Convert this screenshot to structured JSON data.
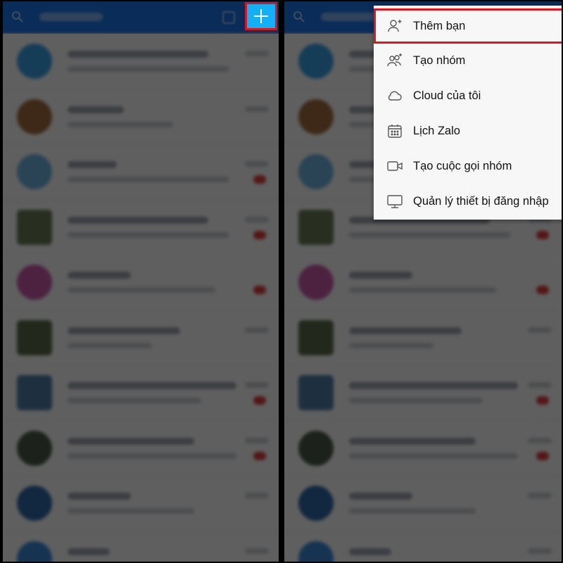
{
  "left_panel": {
    "plus_button_label": "+"
  },
  "right_panel": {
    "menu": {
      "items": [
        {
          "label": "Thêm bạn",
          "icon": "add-friend-icon"
        },
        {
          "label": "Tạo nhóm",
          "icon": "create-group-icon"
        },
        {
          "label": "Cloud của tôi",
          "icon": "cloud-icon"
        },
        {
          "label": "Lịch Zalo",
          "icon": "calendar-icon"
        },
        {
          "label": "Tạo cuộc gọi nhóm",
          "icon": "video-call-icon"
        },
        {
          "label": "Quản lý thiết bị đăng nhập",
          "icon": "monitor-icon"
        }
      ]
    }
  },
  "colors": {
    "header_blue": "#1b73e8",
    "plus_button_bg": "#12b0f7",
    "highlight_red": "#e0121d",
    "menu_bg": "#f7f7f7"
  }
}
